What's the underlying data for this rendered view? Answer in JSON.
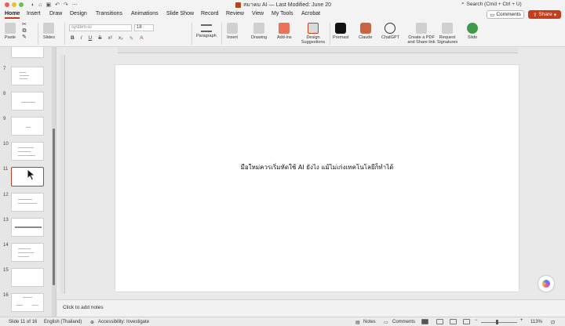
{
  "window": {
    "doc_title": "สมาคม AI — Last Modified: June 20",
    "search_placeholder": "Search (Cmd + Ctrl + U)"
  },
  "tabs": [
    "Home",
    "Insert",
    "Draw",
    "Design",
    "Transitions",
    "Animations",
    "Slide Show",
    "Record",
    "Review",
    "View",
    "My Tools",
    "Acrobat"
  ],
  "header_buttons": {
    "comments": "Comments",
    "share": "Share"
  },
  "ribbon": {
    "paste": "Paste",
    "slides": "Slides",
    "font_name": "system-ui",
    "font_size": "18",
    "format_buttons": [
      "B",
      "I",
      "U",
      "S",
      "x²",
      "x₂"
    ],
    "paragraph": "Paragraph",
    "insert": "Insert",
    "drawing": "Drawing",
    "addins": "Add-ins",
    "design_suggestions": "Design Suggestions",
    "premast": "Premast",
    "claude": "Claude",
    "chatgpt": "ChatGPT",
    "create_pdf": "Create a PDF and Share link",
    "request_signatures": "Request Signatures",
    "slido": "Slido"
  },
  "slide_panel": {
    "numbers": [
      "7",
      "8",
      "9",
      "10",
      "11",
      "12",
      "13",
      "14",
      "15",
      "16"
    ],
    "selected": "11"
  },
  "slide": {
    "text": "มือใหม่ควรเริ่มหัดใช้ AI ยังไง แม้ไม่เก่งเทคโนโลยีก็ทำได้"
  },
  "notes": {
    "placeholder": "Click to add notes"
  },
  "status": {
    "slide_of": "Slide 11 of 16",
    "language": "English (Thailand)",
    "accessibility": "Accessibility: Investigate",
    "notes": "Notes",
    "comments": "Comments",
    "zoom": "113%"
  },
  "colors": {
    "accent": "#c43e1c",
    "selection": "#b6422a"
  }
}
